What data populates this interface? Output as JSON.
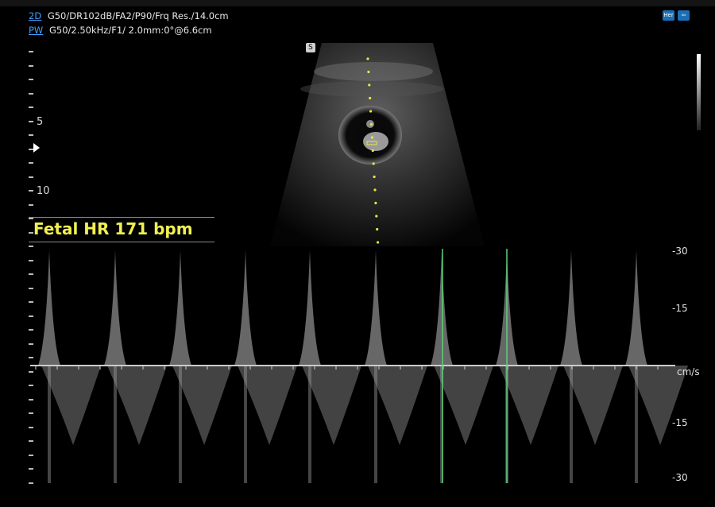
{
  "header": {
    "line1_mode": "2D",
    "line1_params": "G50/DR102dB/FA2/P90/Frq Res./14.0cm",
    "line2_mode": "PW",
    "line2_params": "G50/2.50kHz/F1/ 2.0mm:0°@6.6cm"
  },
  "top_right_icons": [
    "her-icon",
    "exit-icon"
  ],
  "image_badge": "S",
  "depth_scale": {
    "labels": [
      "5",
      "10"
    ]
  },
  "measurement": {
    "fetal_hr": "Fetal HR 171 bpm"
  },
  "doppler_scale": {
    "top": "-30",
    "upper_mid": "-15",
    "unit": "cm/s",
    "lower_mid": "-15",
    "bottom": "-30"
  },
  "colors": {
    "measurement": "#f0f050",
    "mode_link": "#3fa0ff",
    "cursor": "#5ad07a"
  }
}
